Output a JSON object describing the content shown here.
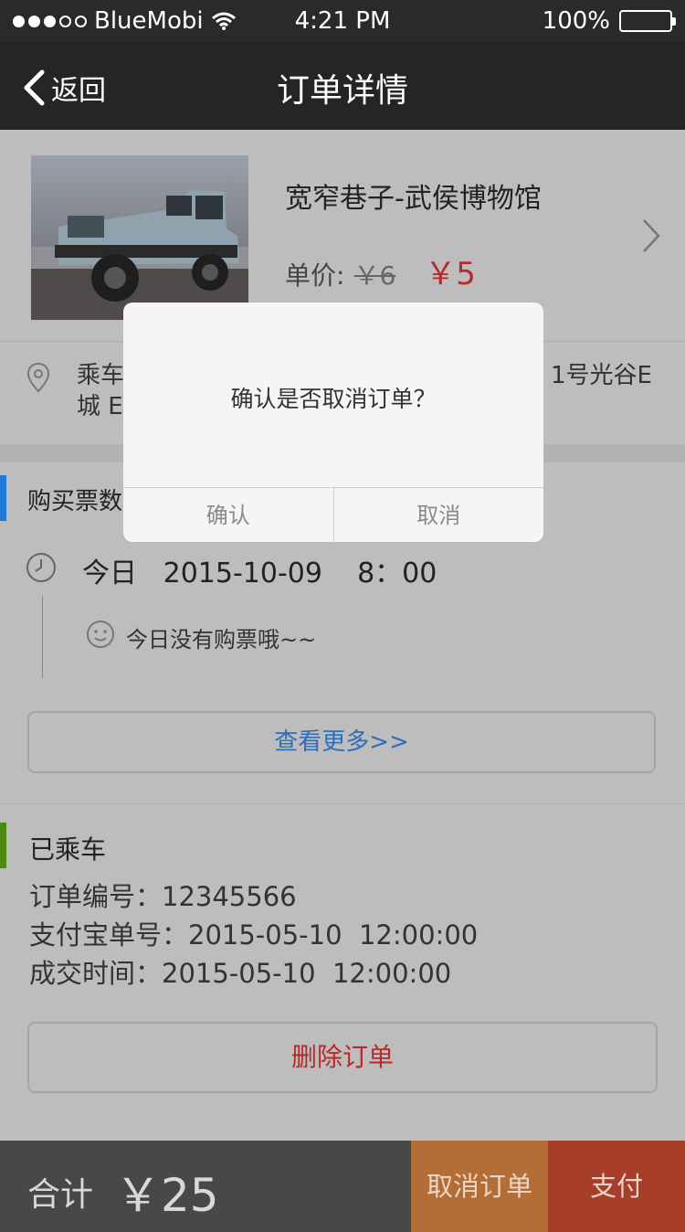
{
  "status_bar": {
    "carrier": "BlueMobi",
    "time": "4:21 PM",
    "battery": "100%"
  },
  "nav": {
    "back_label": "返回",
    "title": "订单详情"
  },
  "product": {
    "title": "宽窄巷子-武侯博物馆",
    "price_label": "单价:",
    "old_price": "￥6",
    "new_price": "￥5"
  },
  "address": {
    "line1_start": "乘车",
    "line1_end": "1号光谷E",
    "line2": "城 E"
  },
  "tickets": {
    "heading": "购买票数",
    "date_line": "今日   2015-10-09    8：00",
    "empty_text": "今日没有购票哦~~",
    "more_button": "查看更多>>"
  },
  "order": {
    "status": "已乘车",
    "order_no": "订单编号：12345566",
    "alipay_no": "支付宝单号：2015-05-10  12:00:00",
    "deal_time": "成交时间：2015-05-10  12:00:00",
    "delete_button": "删除订单"
  },
  "footer": {
    "total_label": "合计",
    "total_value": "￥25",
    "cancel_button": "取消订单",
    "pay_button": "支付"
  },
  "dialog": {
    "message": "确认是否取消订单？",
    "confirm_button": "确认",
    "cancel_button": "取消"
  },
  "colors": {
    "price_red": "#b8292a",
    "tickets_accent": "#1f79d6",
    "order_accent": "#4c8a10",
    "cancel_order_bg": "#b56d37",
    "pay_bg": "#a63e2a"
  },
  "icons": [
    "signal-dots-icon",
    "wifi-icon",
    "battery-icon",
    "back-chevron-icon",
    "chevron-right-icon",
    "location-pin-icon",
    "clock-icon",
    "smiley-icon"
  ]
}
